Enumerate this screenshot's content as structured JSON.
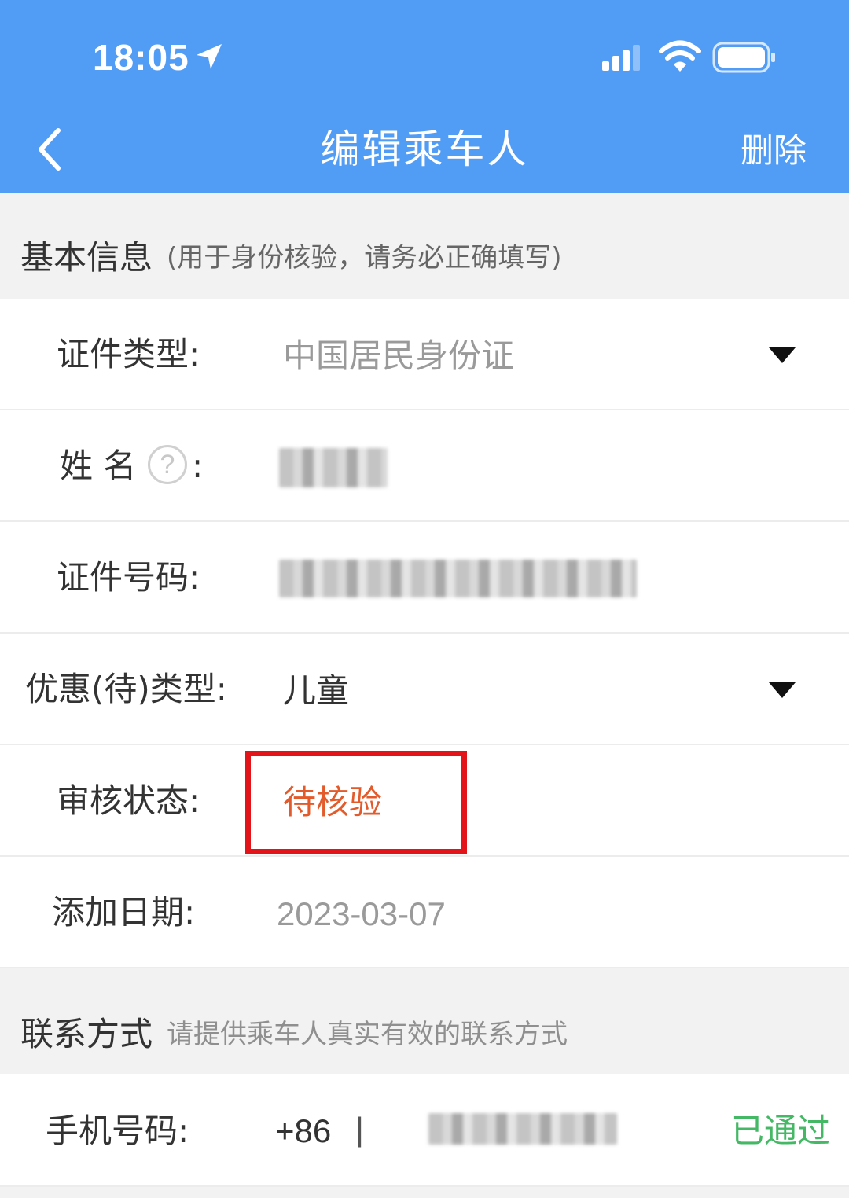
{
  "status_bar": {
    "time": "18:05"
  },
  "nav": {
    "title": "编辑乘车人",
    "delete_label": "删除"
  },
  "basic_info": {
    "title": "基本信息",
    "subtitle": "(用于身份核验，请务必正确填写)",
    "fields": {
      "id_type": {
        "label": "证件类型:",
        "value": "中国居民身份证"
      },
      "name": {
        "label": "姓 名",
        "colon": ":",
        "help": "?"
      },
      "id_number": {
        "label": "证件号码:"
      },
      "discount_type": {
        "label": "优惠(待)类型:",
        "value": "儿童"
      },
      "review_status": {
        "label": "审核状态:",
        "value": "待核验"
      },
      "add_date": {
        "label": "添加日期:",
        "value": "2023-03-07"
      }
    }
  },
  "contact": {
    "title": "联系方式",
    "subtitle": "请提供乘车人真实有效的联系方式",
    "phone": {
      "label": "手机号码:",
      "country_code": "+86",
      "separator": "|",
      "status": "已通过"
    }
  },
  "colors": {
    "header_blue": "#519cf5",
    "status_red": "#e35a2b",
    "verified_green": "#45b866",
    "highlight_red": "#e3141a"
  }
}
